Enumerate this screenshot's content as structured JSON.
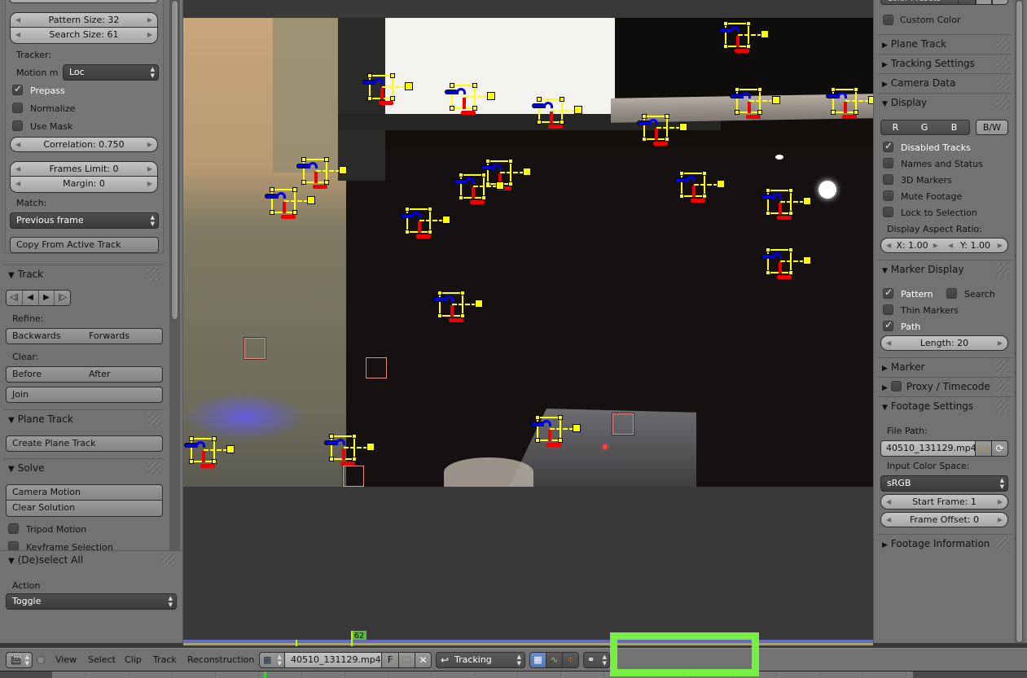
{
  "left_panel": {
    "pattern_size": "Pattern Size: 32",
    "search_size": "Search Size: 61",
    "tracker_label": "Tracker:",
    "motion_model_label": "Motion m",
    "motion_model_value": "Loc",
    "prepass": {
      "label": "Prepass",
      "checked": true
    },
    "normalize": {
      "label": "Normalize",
      "checked": false
    },
    "use_mask": {
      "label": "Use Mask",
      "checked": false
    },
    "correlation": "Correlation: 0.750",
    "frames_limit": "Frames Limit: 0",
    "margin": "Margin: 0",
    "match_label": "Match:",
    "match_value": "Previous frame",
    "copy_from_active": "Copy From Active Track",
    "track_panel": {
      "title": "Track",
      "transport": [
        "◁|",
        "◀",
        "▶",
        "|▷"
      ],
      "refine_label": "Refine:",
      "backwards": "Backwards",
      "forwards": "Forwards",
      "clear_label": "Clear:",
      "before": "Before",
      "after": "After",
      "join": "Join"
    },
    "plane_track_panel": {
      "title": "Plane Track",
      "create": "Create Plane Track"
    },
    "solve_panel": {
      "title": "Solve",
      "camera_motion": "Camera Motion",
      "clear_solution": "Clear Solution",
      "tripod_motion": {
        "label": "Tripod Motion",
        "checked": false
      },
      "keyframe_selection": {
        "label": "Keyframe Selection",
        "checked": false
      }
    },
    "deselect_panel": {
      "title": "(De)select All",
      "action_label": "Action",
      "action_value": "Toggle"
    }
  },
  "clip_editor": {
    "current_frame": "62",
    "colors": {
      "marker": "#ffff00",
      "path_before": "#0000dd",
      "path_after": "#ee0000",
      "disabled_marker": "#f08a8a",
      "current_frame": "#b2ff00"
    }
  },
  "right_panel": {
    "color_presets": "Color Presets",
    "custom_color": {
      "label": "Custom Color",
      "checked": false
    },
    "collapsed_panels": {
      "plane_track": "Plane Track",
      "tracking_settings": "Tracking Settings",
      "camera_data": "Camera Data"
    },
    "display": {
      "title": "Display",
      "channels": [
        "R",
        "G",
        "B"
      ],
      "bw": "B/W",
      "disabled_tracks": {
        "label": "Disabled Tracks",
        "checked": true
      },
      "names_and_status": {
        "label": "Names and Status",
        "checked": false
      },
      "markers_3d": {
        "label": "3D Markers",
        "checked": false
      },
      "mute_footage": {
        "label": "Mute Footage",
        "checked": false
      },
      "lock_to_selection": {
        "label": "Lock to Selection",
        "checked": false
      },
      "aspect_label": "Display Aspect Ratio:",
      "aspect_x": "X: 1.00",
      "aspect_y": "Y: 1.00"
    },
    "marker_display": {
      "title": "Marker Display",
      "pattern": {
        "label": "Pattern",
        "checked": true
      },
      "search": {
        "label": "Search",
        "checked": false
      },
      "thin_markers": {
        "label": "Thin Markers",
        "checked": false
      },
      "path": {
        "label": "Path",
        "checked": true
      },
      "length": "Length: 20"
    },
    "marker_title": "Marker",
    "proxy_title": "Proxy / Timecode",
    "footage_settings": {
      "title": "Footage Settings",
      "file_path_label": "File Path:",
      "file_path": "40510_131129.mp4",
      "color_space_label": "Input Color Space:",
      "color_space": "sRGB",
      "start_frame": "Start Frame: 1",
      "frame_offset": "Frame Offset: 0"
    },
    "footage_information_title": "Footage Information"
  },
  "header": {
    "menus": [
      "View",
      "Select",
      "Clip",
      "Track",
      "Reconstruction"
    ],
    "clip_name": "40510_131129.mp4",
    "fake_user": "F",
    "mode": "Tracking"
  }
}
